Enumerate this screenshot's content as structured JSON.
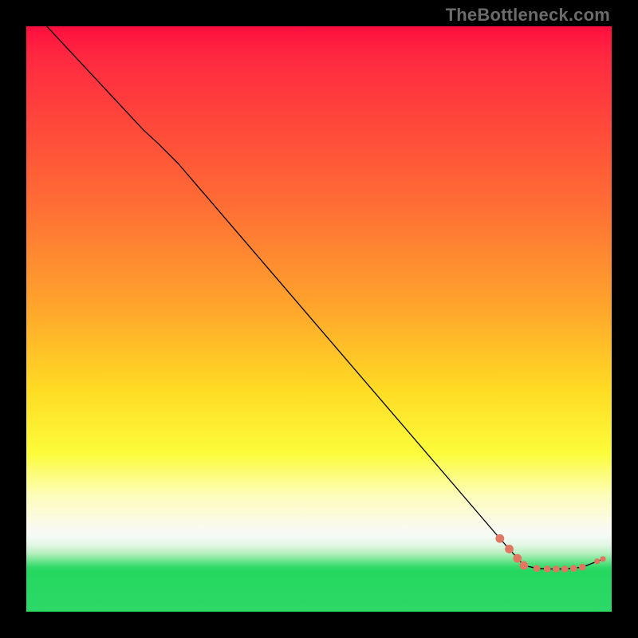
{
  "watermark": "TheBottleneck.com",
  "chart_data": {
    "type": "line",
    "title": "",
    "xlabel": "",
    "ylabel": "",
    "xlim": [
      0,
      100
    ],
    "ylim": [
      0,
      100
    ],
    "grid": false,
    "series": [
      {
        "name": "curve",
        "stroke": "#000000",
        "stroke_width": 1.3,
        "points": [
          {
            "x": 3.5,
            "y": 100.0
          },
          {
            "x": 20.0,
            "y": 82.3
          },
          {
            "x": 22.5,
            "y": 80.0
          },
          {
            "x": 26.0,
            "y": 76.5
          },
          {
            "x": 80.9,
            "y": 12.5
          },
          {
            "x": 82.5,
            "y": 10.7
          },
          {
            "x": 85.0,
            "y": 7.9
          },
          {
            "x": 87.2,
            "y": 7.4
          },
          {
            "x": 89.0,
            "y": 7.3
          },
          {
            "x": 92.0,
            "y": 7.3
          },
          {
            "x": 95.0,
            "y": 7.6
          },
          {
            "x": 97.5,
            "y": 8.6
          },
          {
            "x": 98.5,
            "y": 9.0
          }
        ]
      }
    ],
    "markers": [
      {
        "x": 80.9,
        "y": 12.5,
        "r": 5.4,
        "color": "#e17763"
      },
      {
        "x": 82.5,
        "y": 10.7,
        "r": 5.4,
        "color": "#e17763"
      },
      {
        "x": 83.9,
        "y": 9.1,
        "r": 5.4,
        "color": "#e17763"
      },
      {
        "x": 85.0,
        "y": 7.9,
        "r": 5.4,
        "color": "#e17763"
      },
      {
        "x": 87.2,
        "y": 7.4,
        "r": 4.3,
        "color": "#e17763"
      },
      {
        "x": 89.0,
        "y": 7.3,
        "r": 4.3,
        "color": "#e17763"
      },
      {
        "x": 90.5,
        "y": 7.3,
        "r": 4.3,
        "color": "#e17763"
      },
      {
        "x": 92.0,
        "y": 7.3,
        "r": 4.3,
        "color": "#e17763"
      },
      {
        "x": 93.5,
        "y": 7.4,
        "r": 4.3,
        "color": "#e17763"
      },
      {
        "x": 95.0,
        "y": 7.6,
        "r": 4.3,
        "color": "#e17763"
      },
      {
        "x": 97.5,
        "y": 8.6,
        "r": 3.6,
        "color": "#e17763"
      },
      {
        "x": 98.5,
        "y": 9.0,
        "r": 3.6,
        "color": "#e17763"
      }
    ],
    "gradient_stops": [
      {
        "pct": 0,
        "color": "#ff0e3e"
      },
      {
        "pct": 30,
        "color": "#ff6c35"
      },
      {
        "pct": 48,
        "color": "#ffa52c"
      },
      {
        "pct": 62,
        "color": "#ffdb24"
      },
      {
        "pct": 73,
        "color": "#fcfc3b"
      },
      {
        "pct": 84,
        "color": "#fbfbe0"
      },
      {
        "pct": 91,
        "color": "#6fe58e"
      },
      {
        "pct": 93,
        "color": "#24d75e"
      },
      {
        "pct": 100,
        "color": "#2dd967"
      }
    ]
  }
}
